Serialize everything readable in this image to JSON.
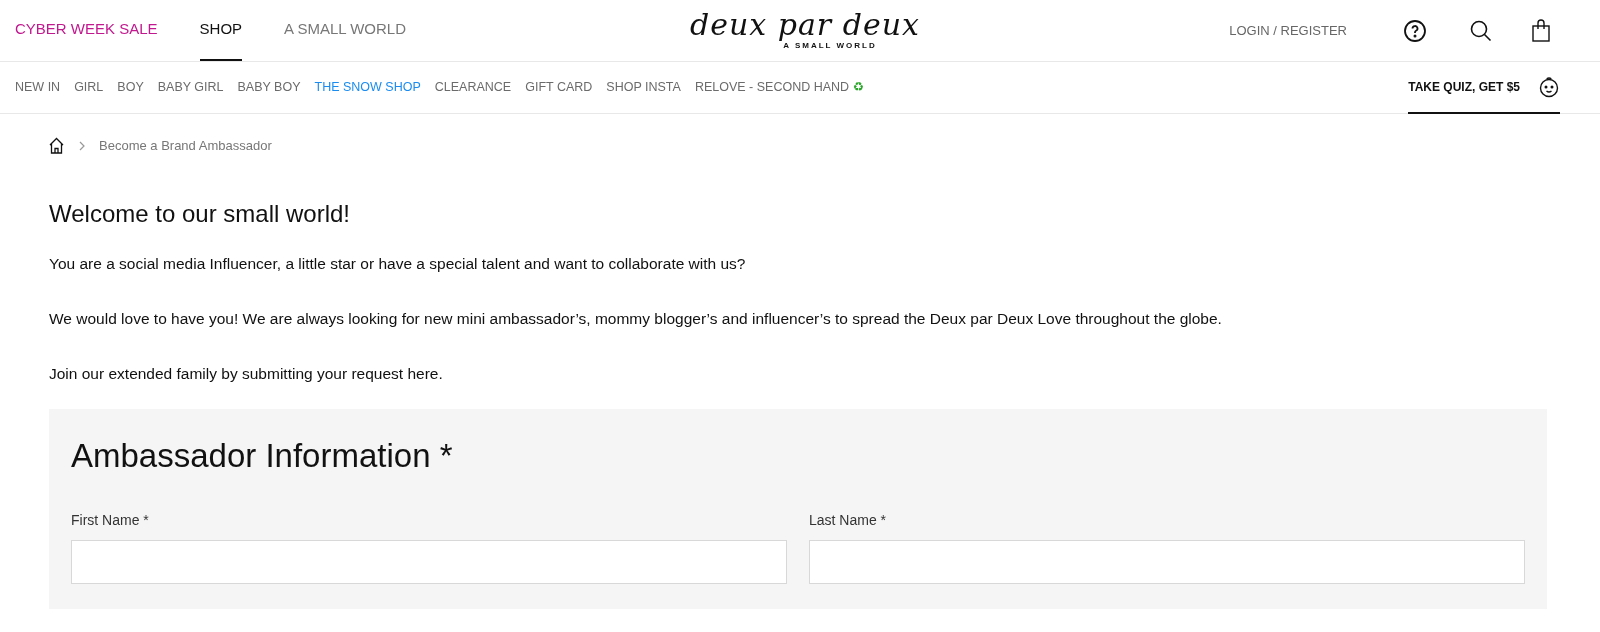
{
  "top_nav": [
    {
      "label": "CYBER WEEK SALE",
      "selected": false,
      "color": "#c2188f"
    },
    {
      "label": "SHOP",
      "selected": true,
      "color": "#111111"
    },
    {
      "label": "A SMALL WORLD",
      "selected": false,
      "color": "#777777"
    }
  ],
  "logo": {
    "wordmark": "deux par deux",
    "tagline": "A SMALL WORLD"
  },
  "account_link": "LOGIN / REGISTER",
  "category_nav": [
    {
      "label": "NEW IN",
      "color": "#6b6b6b"
    },
    {
      "label": "GIRL",
      "color": "#6b6b6b"
    },
    {
      "label": "BOY",
      "color": "#6b6b6b"
    },
    {
      "label": "BABY GIRL",
      "color": "#6b6b6b"
    },
    {
      "label": "BABY BOY",
      "color": "#6b6b6b"
    },
    {
      "label": "THE SNOW SHOP",
      "color": "#1a8cf0"
    },
    {
      "label": "CLEARANCE",
      "color": "#6b6b6b"
    },
    {
      "label": "GIFT CARD",
      "color": "#6b6b6b"
    },
    {
      "label": "SHOP INSTA",
      "color": "#6b6b6b"
    },
    {
      "label": "RELOVE - SECOND HAND",
      "color": "#6b6b6b",
      "symbol": "♻"
    }
  ],
  "quiz_link": {
    "label": "TAKE QUIZ, GET $5",
    "selected": true
  },
  "breadcrumb": [
    "Become a Brand Ambassador"
  ],
  "heading": "Welcome to our small world!",
  "paragraphs": [
    "You are a social media Influencer, a little star or have a special talent and want to collaborate with us?",
    "We would love to have you! We are always looking for new mini ambassador’s, mommy blogger’s and influencer’s to spread the Deux par Deux Love throughout the globe.",
    "Join our extended family by submitting your request here."
  ],
  "form": {
    "title": "Ambassador Information *",
    "fields": [
      {
        "label": "First Name *"
      },
      {
        "label": "Last Name *"
      }
    ]
  }
}
